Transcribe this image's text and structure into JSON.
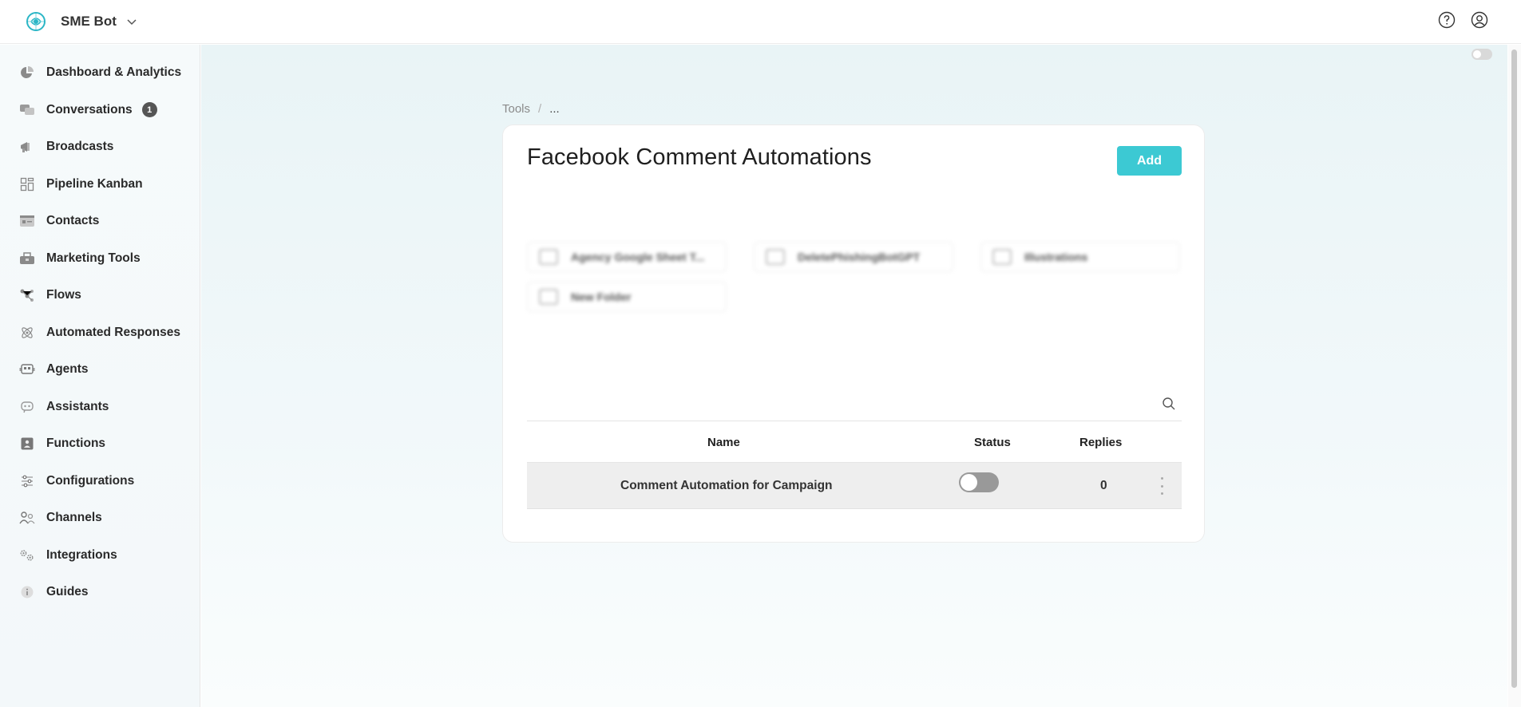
{
  "app": {
    "name": "SME Bot"
  },
  "sidebar": {
    "items": [
      {
        "label": "Dashboard & Analytics",
        "icon": "pie-chart-icon"
      },
      {
        "label": "Conversations",
        "icon": "chat-bubbles-icon",
        "badge": "1"
      },
      {
        "label": "Broadcasts",
        "icon": "megaphone-icon"
      },
      {
        "label": "Pipeline Kanban",
        "icon": "kanban-icon"
      },
      {
        "label": "Contacts",
        "icon": "contact-card-icon"
      },
      {
        "label": "Marketing Tools",
        "icon": "toolbox-icon"
      },
      {
        "label": "Flows",
        "icon": "flow-icon"
      },
      {
        "label": "Automated Responses",
        "icon": "atom-icon"
      },
      {
        "label": "Agents",
        "icon": "robot-icon"
      },
      {
        "label": "Assistants",
        "icon": "assistant-icon"
      },
      {
        "label": "Functions",
        "icon": "function-icon"
      },
      {
        "label": "Configurations",
        "icon": "sliders-icon"
      },
      {
        "label": "Channels",
        "icon": "channels-icon"
      },
      {
        "label": "Integrations",
        "icon": "gears-icon"
      },
      {
        "label": "Guides",
        "icon": "info-icon"
      }
    ]
  },
  "breadcrumb": {
    "root": "Tools",
    "separator": "/",
    "current": "..."
  },
  "page": {
    "title": "Facebook Comment Automations",
    "add_label": "Add"
  },
  "folders": [
    {
      "name": "Agency Google Sheet T..."
    },
    {
      "name": "DeletePhishingBotGPT"
    },
    {
      "name": "Illustrations"
    },
    {
      "name": "New Folder"
    }
  ],
  "table": {
    "columns": {
      "name": "Name",
      "status": "Status",
      "replies": "Replies"
    },
    "rows": [
      {
        "name": "Comment Automation for Campaign",
        "status": "off",
        "replies": "0"
      }
    ]
  },
  "colors": {
    "accent": "#3cc9d3",
    "logo": "#2bb6c6"
  }
}
